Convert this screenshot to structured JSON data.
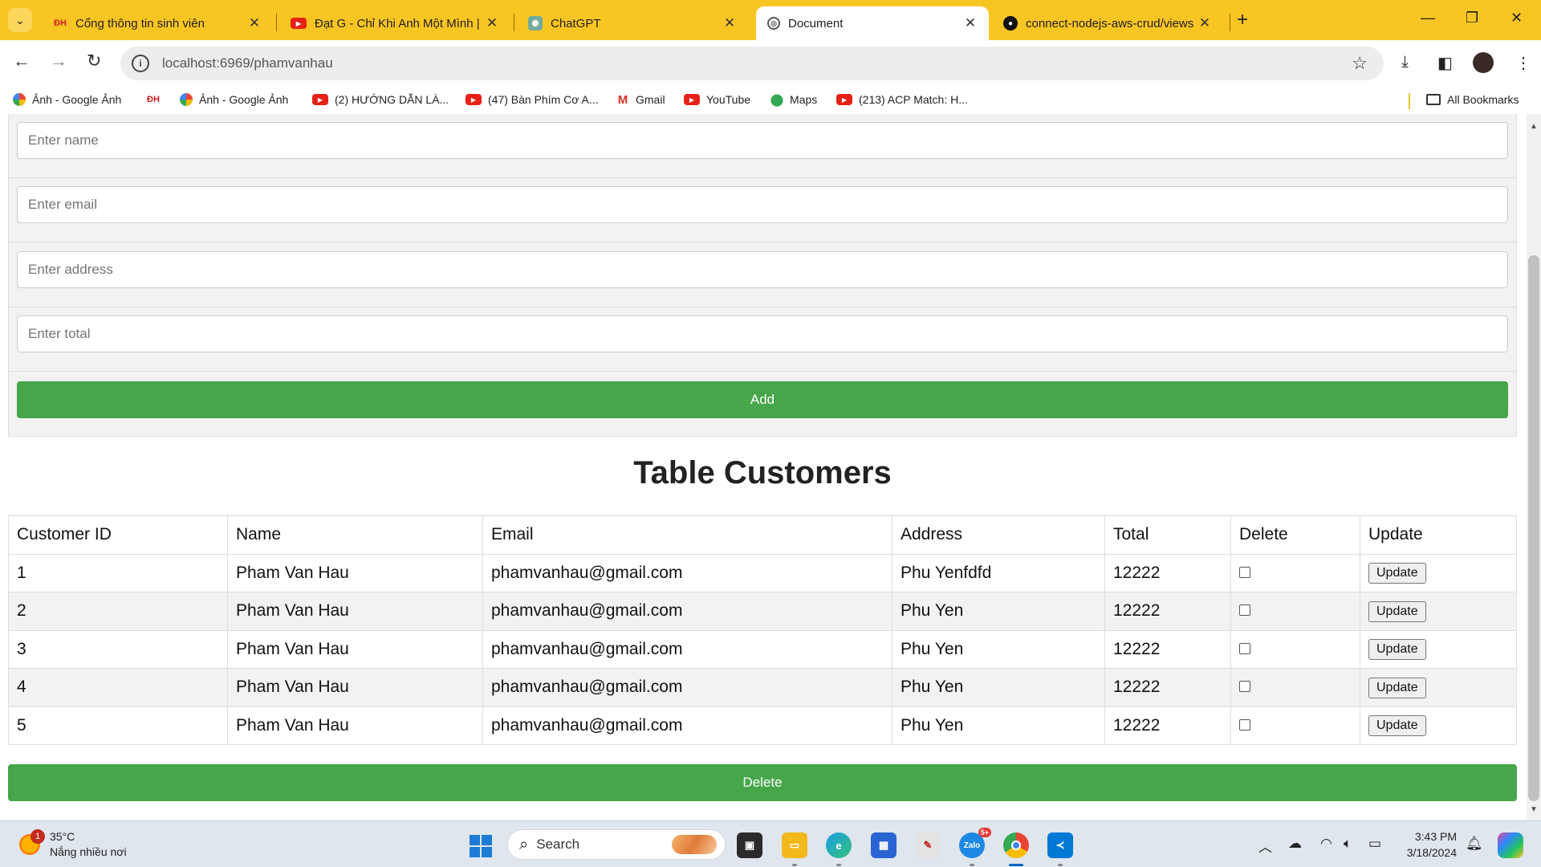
{
  "browser": {
    "tabs": [
      {
        "title": "Cổng thông tin sinh viên",
        "icon": "vnu-icon"
      },
      {
        "title": "Đạt G - Chỉ Khi Anh Một Mình |",
        "icon": "youtube-icon"
      },
      {
        "title": "ChatGPT",
        "icon": "chatgpt-icon"
      },
      {
        "title": "Document",
        "icon": "globe-icon"
      },
      {
        "title": "connect-nodejs-aws-crud/views",
        "icon": "github-icon"
      }
    ],
    "url_host": "localhost",
    "url_path": ":6969/phamvanhau",
    "bookmarks": [
      {
        "label": "Ảnh - Google Ảnh",
        "icon": "photos"
      },
      {
        "label": "",
        "icon": "vnu"
      },
      {
        "label": "Ảnh - Google Ảnh",
        "icon": "photos"
      },
      {
        "label": "(2) HƯỚNG DẪN LÀ...",
        "icon": "yt"
      },
      {
        "label": "(47) Bàn Phím Cơ A...",
        "icon": "yt"
      },
      {
        "label": "Gmail",
        "icon": "gmail"
      },
      {
        "label": "YouTube",
        "icon": "yt"
      },
      {
        "label": "Maps",
        "icon": "maps"
      },
      {
        "label": "(213) ACP Match: H...",
        "icon": "yt"
      }
    ],
    "all_bookmarks": "All Bookmarks"
  },
  "form": {
    "name_placeholder": "Enter name",
    "email_placeholder": "Enter email",
    "address_placeholder": "Enter address",
    "total_placeholder": "Enter total",
    "add_label": "Add"
  },
  "table": {
    "title": "Table Customers",
    "headers": [
      "Customer ID",
      "Name",
      "Email",
      "Address",
      "Total",
      "Delete",
      "Update"
    ],
    "update_label": "Update",
    "rows": [
      {
        "id": "1",
        "name": "Pham Van Hau",
        "email": "phamvanhau@gmail.com",
        "address": "Phu Yenfdfd",
        "total": "12222"
      },
      {
        "id": "2",
        "name": "Pham Van Hau",
        "email": "phamvanhau@gmail.com",
        "address": "Phu Yen",
        "total": "12222"
      },
      {
        "id": "3",
        "name": "Pham Van Hau",
        "email": "phamvanhau@gmail.com",
        "address": "Phu Yen",
        "total": "12222"
      },
      {
        "id": "4",
        "name": "Pham Van Hau",
        "email": "phamvanhau@gmail.com",
        "address": "Phu Yen",
        "total": "12222"
      },
      {
        "id": "5",
        "name": "Pham Van Hau",
        "email": "phamvanhau@gmail.com",
        "address": "Phu Yen",
        "total": "12222"
      }
    ],
    "delete_label": "Delete"
  },
  "taskbar": {
    "weather_temp": "35°C",
    "weather_desc": "Nắng nhiều nơi",
    "weather_badge": "1",
    "search_label": "Search",
    "zalo_badge": "5+",
    "time": "3:43 PM",
    "date": "3/18/2024"
  },
  "colors": {
    "tabbar": "#f9c523",
    "button_green": "#46a64a"
  }
}
